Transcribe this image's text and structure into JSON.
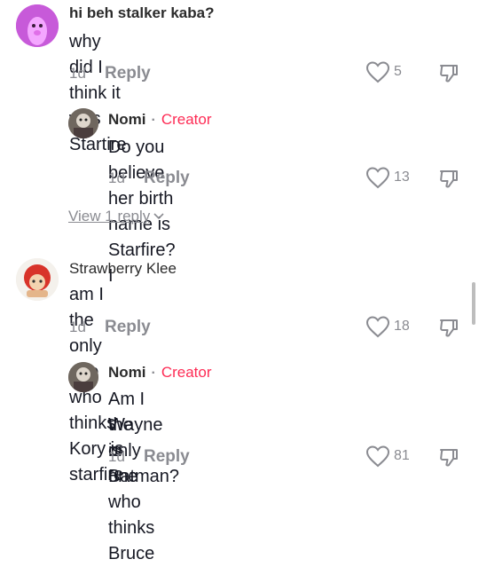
{
  "comments": [
    {
      "username": "hi beh stalker kaba?",
      "text": "why did I think it was Startire",
      "time": "1d",
      "reply_label": "Reply",
      "likes": "5",
      "avatar_color": "#c85bd8"
    },
    {
      "username": "Nomi",
      "badge": "Creator",
      "text": "Do you believe her birth name is Starfire? I",
      "time": "1d",
      "reply_label": "Reply",
      "likes": "13"
    },
    {
      "username": "Strawberry Klee",
      "text": "am I the only one who thinks Kory is starfire",
      "time": "1d",
      "reply_label": "Reply",
      "likes": "18"
    },
    {
      "username": "Nomi",
      "badge": "Creator",
      "text_line1": "Am I the only one who thinks Bruce",
      "text_line2": "Wayne is Batman?",
      "time": "1d",
      "reply_label": "Reply",
      "likes": "81"
    }
  ],
  "view_replies_label": "View 1 reply",
  "colors": {
    "accent": "#fe2c55",
    "muted": "#8a8b91",
    "text": "#161823"
  }
}
